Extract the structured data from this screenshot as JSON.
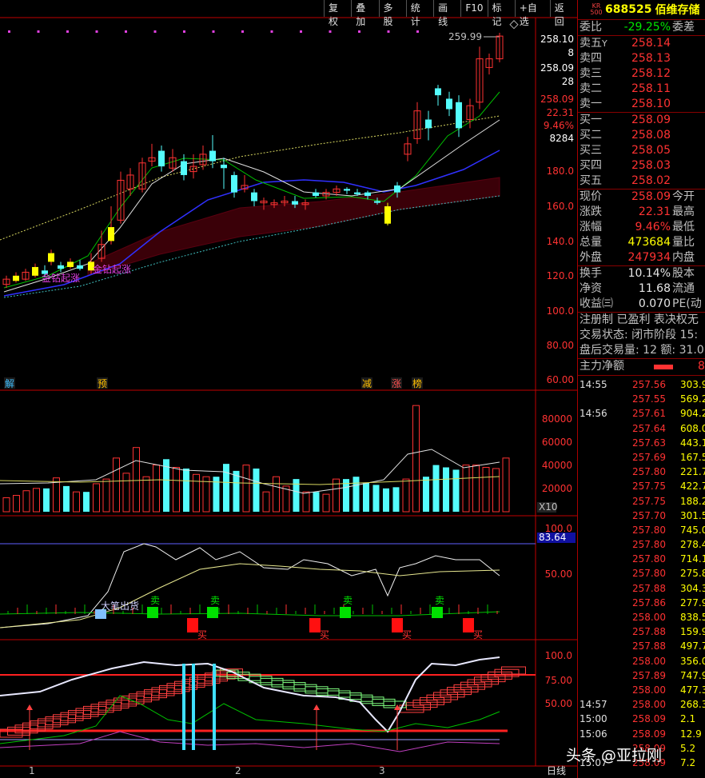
{
  "toolbar": [
    "复权",
    "叠加",
    "多股",
    "统计",
    "画线",
    "F10",
    "标记",
    "+自选",
    "返回"
  ],
  "stock": {
    "logo_line1": "KR",
    "logo_line2": "500",
    "code": "688525",
    "name": "佰维存储"
  },
  "price_axis": [
    "258.10",
    "8",
    "258.09",
    "28",
    "258.09",
    "22.31",
    "9.46%",
    "8284",
    "180.0",
    "160.0",
    "140.0",
    "120.0",
    "100.0",
    "80.00",
    "60.00"
  ],
  "high_label": "259.99",
  "vol_axis": [
    "80000",
    "60000",
    "40000",
    "20000",
    "X10"
  ],
  "ind_axis": [
    "100.0",
    "83.64",
    "50.00"
  ],
  "kdj_axis": [
    "100.0",
    "75.00",
    "50.00"
  ],
  "date_labels": [
    "1",
    "2",
    "3"
  ],
  "period_label": "日线",
  "chart_tags": [
    "解",
    "预",
    "减",
    "涨",
    "榜"
  ],
  "annotations": {
    "gold1": "金钻起涨",
    "gold2": "金钻起涨",
    "big_buy": "大笔出货",
    "sell": "卖",
    "buy": "买"
  },
  "panel": {
    "weibi": {
      "label": "委比",
      "value": "-29.25%",
      "label2": "委差"
    },
    "asks": [
      {
        "label": "卖五",
        "flag": "Y",
        "price": "258.14"
      },
      {
        "label": "卖四",
        "price": "258.13"
      },
      {
        "label": "卖三",
        "price": "258.12"
      },
      {
        "label": "卖二",
        "price": "258.11"
      },
      {
        "label": "卖一",
        "price": "258.10"
      }
    ],
    "bids": [
      {
        "label": "买一",
        "price": "258.09"
      },
      {
        "label": "买二",
        "price": "258.08"
      },
      {
        "label": "买三",
        "price": "258.05"
      },
      {
        "label": "买四",
        "price": "258.03"
      },
      {
        "label": "买五",
        "price": "258.02"
      }
    ],
    "quotes": [
      {
        "label": "现价",
        "value": "258.09",
        "label2": "今开",
        "cls": "red"
      },
      {
        "label": "涨跌",
        "value": "22.31",
        "label2": "最高",
        "cls": "red"
      },
      {
        "label": "涨幅",
        "value": "9.46%",
        "label2": "最低",
        "cls": "red"
      },
      {
        "label": "总量",
        "value": "473684",
        "label2": "量比",
        "cls": "yellow"
      },
      {
        "label": "外盘",
        "value": "247934",
        "label2": "内盘",
        "cls": "red"
      }
    ],
    "stats": [
      {
        "label": "换手",
        "value": "10.14%",
        "label2": "股本"
      },
      {
        "label": "净资",
        "value": "11.68",
        "label2": "流通"
      },
      {
        "label": "收益㈢",
        "value": "0.070",
        "label2": "PE(动"
      }
    ],
    "info": [
      "注册制 已盈利 表决权无",
      "交易状态: 闭市阶段 15:",
      "盘后交易量: 12  额: 31.0"
    ],
    "main_flow": {
      "label": "主力净额",
      "value": "8"
    },
    "ticks": [
      {
        "t": "14:55",
        "p": "257.56",
        "v": "303.9"
      },
      {
        "t": "",
        "p": "257.55",
        "v": "569.2"
      },
      {
        "t": "14:56",
        "p": "257.61",
        "v": "904.2"
      },
      {
        "t": "",
        "p": "257.64",
        "v": "608.0"
      },
      {
        "t": "",
        "p": "257.63",
        "v": "443.1"
      },
      {
        "t": "",
        "p": "257.69",
        "v": "167.5"
      },
      {
        "t": "",
        "p": "257.80",
        "v": "221.7"
      },
      {
        "t": "",
        "p": "257.75",
        "v": "422.7"
      },
      {
        "t": "",
        "p": "257.75",
        "v": "188.2"
      },
      {
        "t": "",
        "p": "257.70",
        "v": "301.5"
      },
      {
        "t": "",
        "p": "257.80",
        "v": "745.0"
      },
      {
        "t": "",
        "p": "257.80",
        "v": "278.4"
      },
      {
        "t": "",
        "p": "257.80",
        "v": "714.1"
      },
      {
        "t": "",
        "p": "257.80",
        "v": "275.8"
      },
      {
        "t": "",
        "p": "257.88",
        "v": "304.3"
      },
      {
        "t": "",
        "p": "257.86",
        "v": "277.9"
      },
      {
        "t": "",
        "p": "258.00",
        "v": "838.5"
      },
      {
        "t": "",
        "p": "257.88",
        "v": "159.9"
      },
      {
        "t": "",
        "p": "257.88",
        "v": "497.7"
      },
      {
        "t": "",
        "p": "258.00",
        "v": "356.0"
      },
      {
        "t": "",
        "p": "257.89",
        "v": "747.9"
      },
      {
        "t": "",
        "p": "258.00",
        "v": "477.3"
      },
      {
        "t": "14:57",
        "p": "258.00",
        "v": "268.3"
      },
      {
        "t": "15:00",
        "p": "258.09",
        "v": "2.1"
      },
      {
        "t": "15:06",
        "p": "258.09",
        "v": "12.9"
      },
      {
        "t": "",
        "p": "258.09",
        "v": "5.2"
      },
      {
        "t": "15:07",
        "p": "258.09",
        "v": "7.2"
      }
    ]
  },
  "watermark": "头条 @亚拉刚",
  "colors": {
    "up": "#ff3232",
    "down": "#54fcfc",
    "axis": "#c00000",
    "bg": "#000000",
    "yellow": "#ffff00"
  }
}
